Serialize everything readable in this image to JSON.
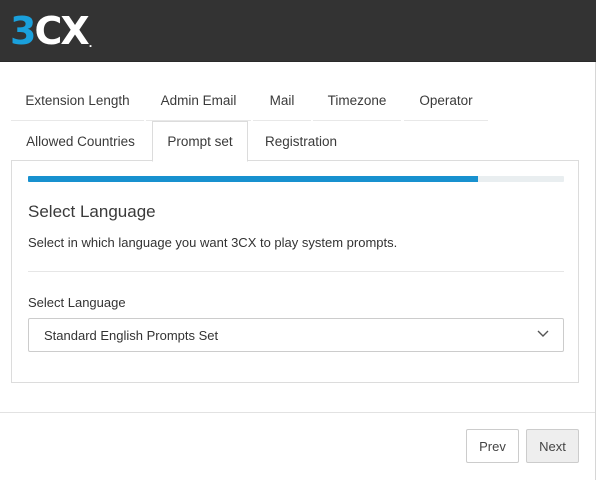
{
  "header": {
    "logo": {
      "part1": "3",
      "part2": "CX",
      "dot": "."
    },
    "colors": {
      "background": "#333333",
      "logo_accent": "#1aa0dc"
    }
  },
  "tabs": [
    {
      "label": "Extension Length"
    },
    {
      "label": "Admin Email"
    },
    {
      "label": "Mail"
    },
    {
      "label": "Timezone"
    },
    {
      "label": "Operator"
    },
    {
      "label": "Allowed Countries"
    },
    {
      "label": "Prompt set",
      "active": true
    },
    {
      "label": "Registration"
    }
  ],
  "progress": {
    "percent": 84,
    "color": "#1891cf"
  },
  "section": {
    "title": "Select Language",
    "description": "Select in which language you want 3CX to play system prompts."
  },
  "language_field": {
    "label": "Select Language",
    "selected": "Standard English Prompts Set",
    "icon": "chevron-down-icon"
  },
  "footer": {
    "prev_label": "Prev",
    "next_label": "Next"
  }
}
